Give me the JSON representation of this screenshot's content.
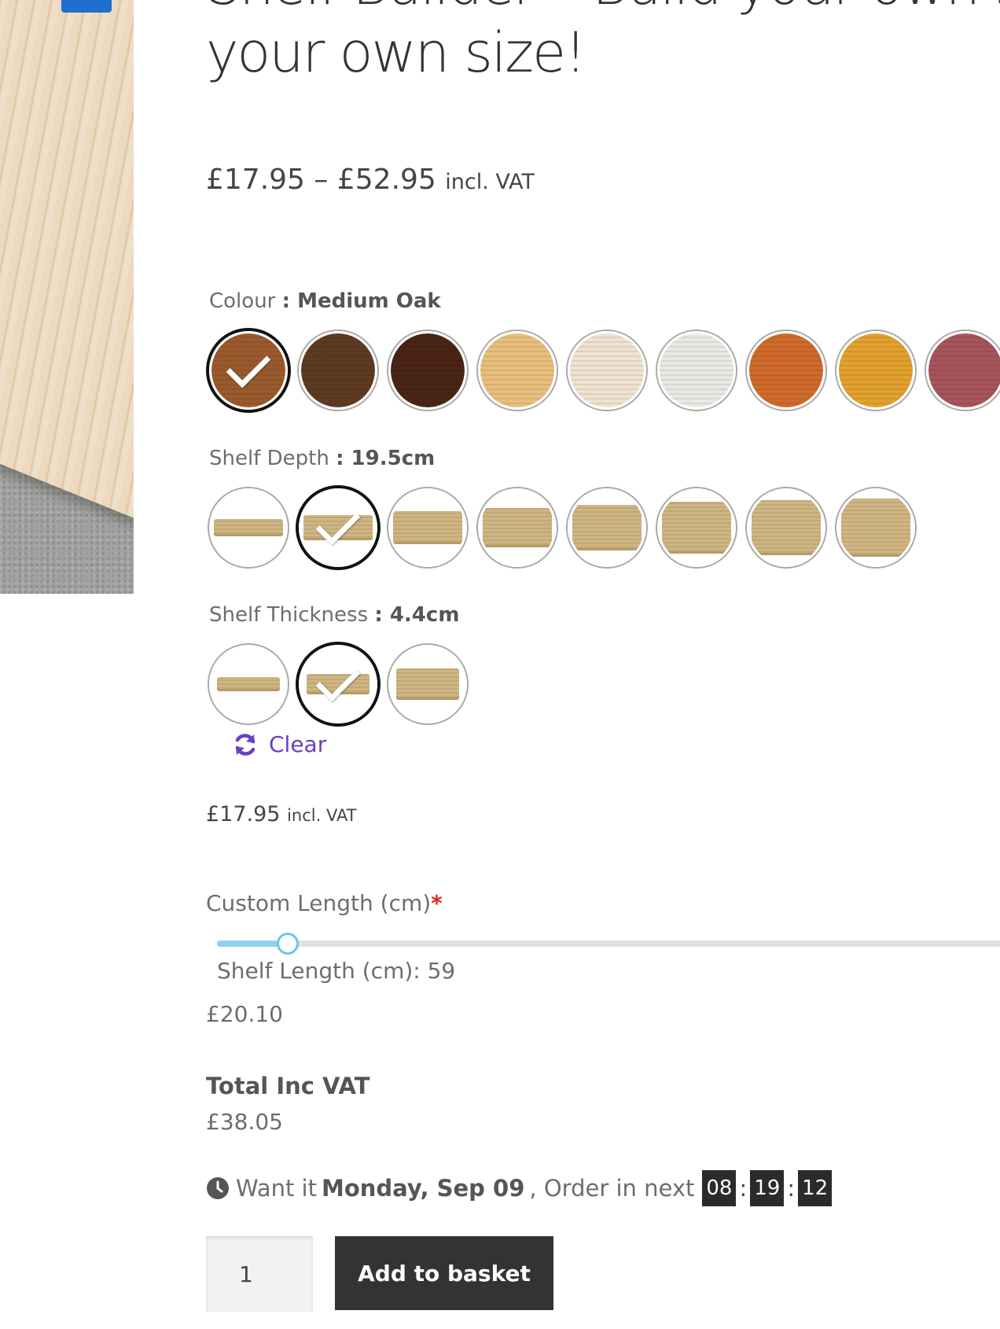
{
  "product": {
    "title_line1": "Shelf Builder – Build your own shelf",
    "title_line2": "your own size!",
    "price_range": "£17.95 – £52.95",
    "price_vat_suffix": "incl. VAT"
  },
  "colour": {
    "label": "Colour",
    "selected": "Medium Oak",
    "swatch_colors": [
      "#9a5a2c",
      "#5e3a22",
      "#4a2415",
      "#e8be7c",
      "#efe2cf",
      "#e9e8e3",
      "#cf6a2a",
      "#e2a12e",
      "#a6545a"
    ]
  },
  "depth": {
    "label": "Shelf Depth",
    "selected": "19.5cm",
    "swatch_count": 8
  },
  "thickness": {
    "label": "Shelf Thickness",
    "selected": "4.4cm",
    "swatch_count": 3
  },
  "clear_label": "Clear",
  "variation_price": {
    "amount": "£17.95",
    "vat": "incl. VAT"
  },
  "custom_length": {
    "label": "Custom Length (cm)",
    "required_mark": "*",
    "slider_fraction": 0.09,
    "readout": "Shelf Length (cm): 59",
    "price": "£20.10"
  },
  "total": {
    "label": "Total Inc VAT",
    "value": "£38.05"
  },
  "delivery": {
    "prefix": "Want it",
    "date": "Monday, Sep 09",
    "middle": ", Order in next",
    "hours": "08",
    "minutes": "19",
    "seconds": "12"
  },
  "cart": {
    "quantity": "1",
    "add_button": "Add to basket"
  },
  "colors": {
    "accent_purple": "#6a3fc4",
    "slider_blue": "#8fd2ef",
    "button_dark": "#333333",
    "required_red": "#e2231a"
  }
}
